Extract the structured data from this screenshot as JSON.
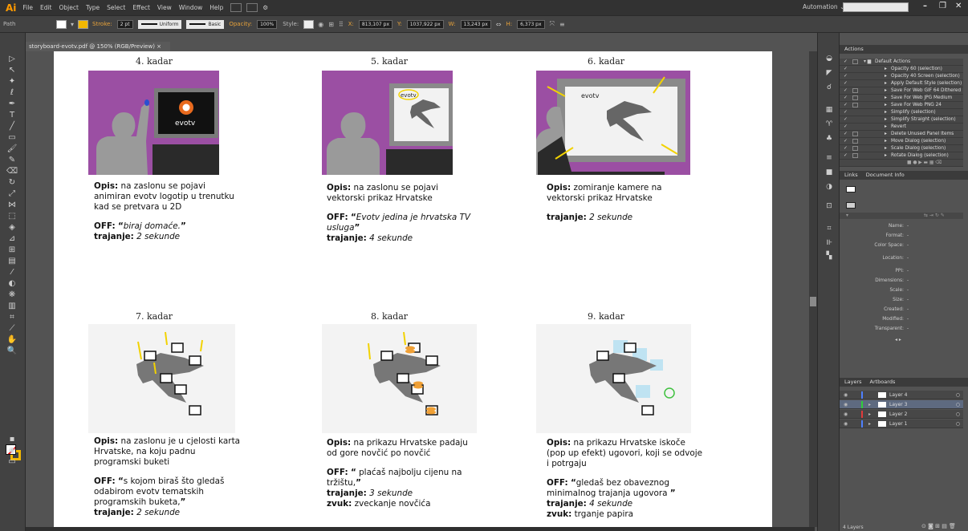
{
  "menubar": {
    "logo": "Ai",
    "items": [
      "File",
      "Edit",
      "Object",
      "Type",
      "Select",
      "Effect",
      "View",
      "Window",
      "Help"
    ],
    "workspace": "Automation ⌄"
  },
  "controlbar": {
    "selection_type": "Path",
    "stroke_label": "Stroke:",
    "stroke_weight": "2 pt",
    "profile": "Uniform",
    "brush": "Basic",
    "opacity_label": "Opacity:",
    "opacity": "100%",
    "style_label": "Style:",
    "x_label": "X:",
    "x": "813,107 px",
    "y_label": "Y:",
    "y": "1037,922 px",
    "w_label": "W:",
    "w": "13,243 px",
    "h_label": "H:",
    "h": "6,373 px",
    "fill_color": "#ffffff",
    "stroke_color": "#f2b700"
  },
  "document": {
    "tab_title": "storyboard-evotv.pdf @ 150% (RGB/Preview)"
  },
  "frames": [
    {
      "title": "4. kadar",
      "opis": "na zaslonu se pojavi animiran evotv logotip u trenutku kad se pretvara u 2D",
      "off": "biraj domaće.",
      "trajanje": "2 sekunde"
    },
    {
      "title": "5. kadar",
      "opis": "na zaslonu se pojavi vektorski prikaz Hrvatske",
      "off": "Evotv jedina je hrvatska TV usluga",
      "trajanje": "4 sekunde"
    },
    {
      "title": "6. kadar",
      "opis": "zomiranje kamere na vektorski prikaz Hrvatske",
      "trajanje": "2 sekunde"
    },
    {
      "title": "7. kadar",
      "opis": "na zaslonu je u cjelosti karta Hrvatske, na koju padnu programski buketi",
      "off": "s kojom biraš što gledaš odabirom evotv tematskih programskih buketa,",
      "trajanje": "2 sekunde"
    },
    {
      "title": "8. kadar",
      "opis": "na prikazu Hrvatske padaju od gore novčić po novčić",
      "off": " plaćaš najbolju cijenu na tržištu,",
      "trajanje": "3 sekunde",
      "zvuk": "zveckanje novčića"
    },
    {
      "title": "9. kadar",
      "opis": "na prikazu Hrvatske iskoče (pop up efekt) ugovori, koji se odvoje i potrgaju",
      "off": "gledaš bez obaveznog minimalnog trajanja ugovora ",
      "trajanje": "4 sekunde",
      "zvuk": "trganje papira"
    }
  ],
  "labels": {
    "opis": "Opis:",
    "off": "OFF:",
    "trajanje": "trajanje:",
    "zvuk": "zvuk:",
    "brand": "evotv"
  },
  "actions_panel": {
    "tab": "Actions",
    "set": "Default Actions",
    "items": [
      "Opacity 60 (selection)",
      "Opacity 40 Screen (selection)",
      "Apply Default Style (selection)",
      "Save For Web GIF 64 Dithered",
      "Save For Web JPG Medium",
      "Save For Web PNG 24",
      "Simplify (selection)",
      "Simplify Straight (selection)",
      "Revert",
      "Delete Unused Panel Items",
      "Move Dialog (selection)",
      "Scale Dialog (selection)",
      "Rotate Dialog (selection)"
    ]
  },
  "links_panel": {
    "tabs": [
      "Links",
      "Document Info"
    ],
    "fields": [
      "Name:",
      "Format:",
      "Color Space:",
      "Location:",
      "PPI:",
      "Dimensions:",
      "Scale:",
      "Size:",
      "Created:",
      "Modified:",
      "Transparent:"
    ],
    "empty_value": "-"
  },
  "layers_panel": {
    "tabs": [
      "Layers",
      "Artboards"
    ],
    "layers": [
      {
        "name": "Layer 4",
        "color": "#4f80ff",
        "selected": false
      },
      {
        "name": "Layer 3",
        "color": "#2fcf3a",
        "selected": true
      },
      {
        "name": "Layer 2",
        "color": "#e23b3b",
        "selected": false
      },
      {
        "name": "Layer 1",
        "color": "#4f80ff",
        "selected": false
      }
    ],
    "count": "4 Layers"
  }
}
